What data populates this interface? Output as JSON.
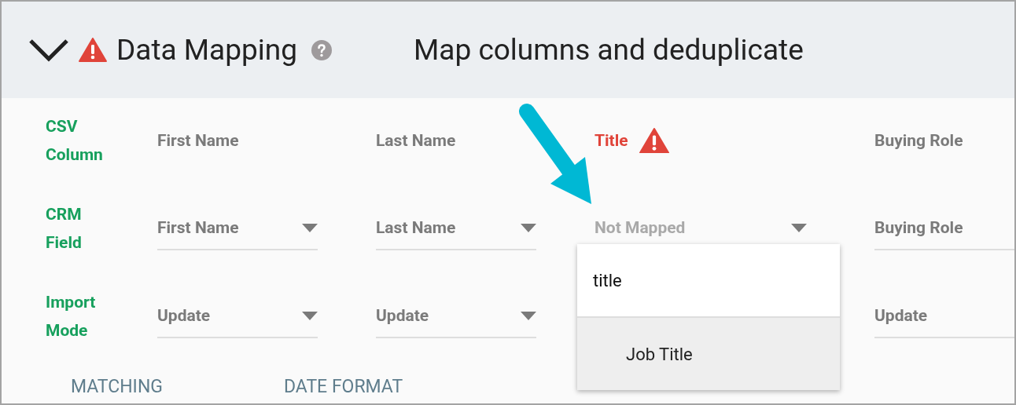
{
  "section": {
    "title": "Data Mapping",
    "subtitle": "Map columns and deduplicate",
    "expanded": true,
    "warning": true
  },
  "row_labels": [
    "CSV Column",
    "CRM Field",
    "Import Mode"
  ],
  "columns": [
    {
      "csv_column": "First Name",
      "warning": false,
      "crm_field": "First Name",
      "mapped": true,
      "open": false,
      "import_mode": "Update"
    },
    {
      "csv_column": "Last Name",
      "warning": false,
      "crm_field": "Last Name",
      "mapped": true,
      "open": false,
      "import_mode": "Update"
    },
    {
      "csv_column": "Title",
      "warning": true,
      "crm_field": "Not Mapped",
      "mapped": false,
      "open": true
    },
    {
      "csv_column": "Buying Role",
      "warning": false,
      "crm_field": "Buying Role",
      "mapped": true,
      "open": false,
      "import_mode": "Update"
    }
  ],
  "dropdown": {
    "search_value": "title",
    "options": [
      {
        "label": "Job Title",
        "selected": true
      }
    ]
  },
  "tabs": [
    {
      "label": "MATCHING"
    },
    {
      "label": "DATE FORMAT"
    }
  ]
}
